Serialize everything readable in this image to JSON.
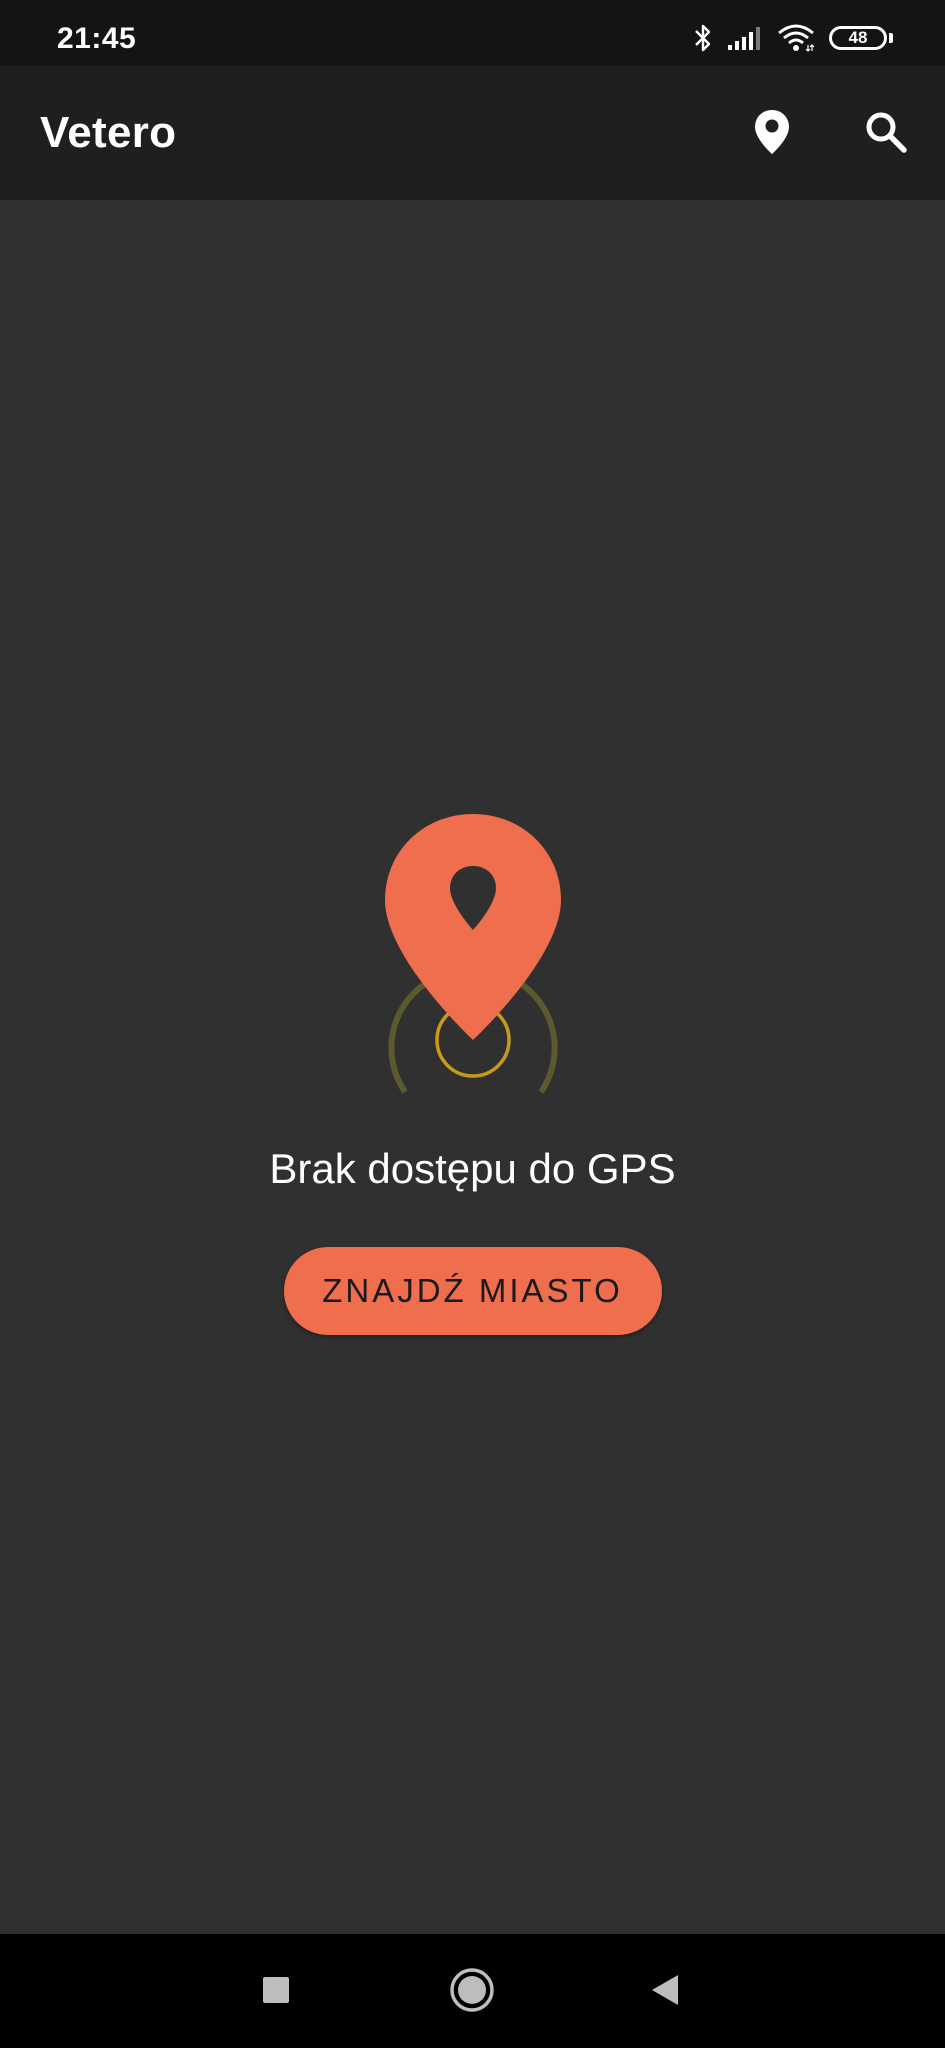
{
  "status_bar": {
    "time": "21:45",
    "battery_level": "48",
    "icons": [
      "bluetooth-icon",
      "signal-icon",
      "wifi-icon",
      "battery-icon"
    ]
  },
  "app_bar": {
    "title": "Vetero",
    "actions": [
      "location-pin-icon",
      "search-icon"
    ]
  },
  "empty_state": {
    "illustration": "location-pin-radar-icon",
    "message": "Brak dostępu do GPS",
    "button_label": "ZNAJDŹ MIASTO"
  },
  "nav_bar": {
    "buttons": [
      "recents-icon",
      "home-icon",
      "back-icon"
    ]
  },
  "colors": {
    "background": "#303030",
    "app_bar": "#1f1f1f",
    "status_bar": "#141414",
    "accent": "#ee6e4d",
    "radar_outer": "#5a5a2e",
    "radar_inner": "#c79a1a",
    "nav_bar": "#000000"
  }
}
